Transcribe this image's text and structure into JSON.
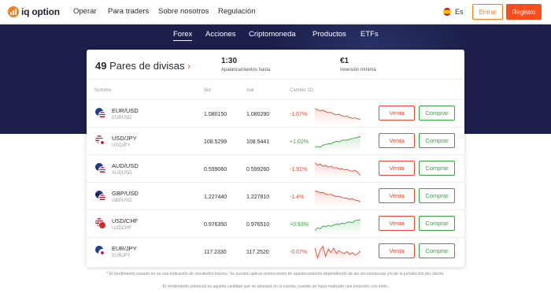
{
  "header": {
    "logo_text": "iq option",
    "nav": [
      "Operar",
      "Para traders",
      "Sobre nosotros",
      "Regulación"
    ],
    "language": "Es",
    "entrar_label": "Entrar",
    "registro_label": "Registro"
  },
  "tabs": [
    "Forex",
    "Acciones",
    "Criptomoneda",
    "Productos",
    "ETFs"
  ],
  "card": {
    "pairs_count": "49",
    "pairs_label": " Pares de divisas",
    "leverage_value": "1:30",
    "leverage_label": "Apalancamientos hasta",
    "min_invest_value": "€1",
    "min_invest_label": "Inversión mínima",
    "columns": [
      "Nombre",
      "Bid",
      "Ask",
      "Cambio 1D"
    ],
    "sell_label": "Venta",
    "buy_label": "Comprar"
  },
  "rows": [
    {
      "symbol": "EUR/USD",
      "sub": "EURUSD",
      "bid": "1.080150",
      "ask": "1.080290",
      "change": "-1.07%",
      "direction": "down",
      "flags": [
        "eu",
        "us"
      ],
      "trend": [
        0.2,
        0.28,
        0.32,
        0.3,
        0.38,
        0.44,
        0.42,
        0.5,
        0.55,
        0.52,
        0.6,
        0.66,
        0.62,
        0.7,
        0.75,
        0.72,
        0.78,
        0.8
      ]
    },
    {
      "symbol": "USD/JPY",
      "sub": "USDJPY",
      "bid": "108.5299",
      "ask": "108.5441",
      "change": "+1.02%",
      "direction": "up",
      "flags": [
        "us",
        "jp"
      ],
      "trend": [
        0.8,
        0.78,
        0.82,
        0.7,
        0.68,
        0.62,
        0.64,
        0.55,
        0.5,
        0.52,
        0.45,
        0.42,
        0.44,
        0.38,
        0.35,
        0.3,
        0.28,
        0.22
      ]
    },
    {
      "symbol": "AUD/USD",
      "sub": "AUDUSD",
      "bid": "0.599060",
      "ask": "0.599260",
      "change": "-1.91%",
      "direction": "down",
      "flags": [
        "au",
        "us"
      ],
      "trend": [
        0.15,
        0.3,
        0.22,
        0.35,
        0.3,
        0.4,
        0.35,
        0.45,
        0.42,
        0.5,
        0.48,
        0.55,
        0.52,
        0.6,
        0.62,
        0.58,
        0.7,
        0.85
      ]
    },
    {
      "symbol": "GBP/USD",
      "sub": "GBPUSD",
      "bid": "1.227440",
      "ask": "1.227810",
      "change": "-1.4%",
      "direction": "down",
      "flags": [
        "gb",
        "us"
      ],
      "trend": [
        0.2,
        0.22,
        0.3,
        0.28,
        0.36,
        0.4,
        0.38,
        0.45,
        0.5,
        0.48,
        0.55,
        0.58,
        0.6,
        0.65,
        0.62,
        0.7,
        0.72,
        0.8
      ]
    },
    {
      "symbol": "USD/CHF",
      "sub": "USDCHF",
      "bid": "0.976350",
      "ask": "0.976510",
      "change": "+0.93%",
      "direction": "up",
      "flags": [
        "us",
        "ch"
      ],
      "trend": [
        0.85,
        0.7,
        0.75,
        0.6,
        0.65,
        0.58,
        0.62,
        0.55,
        0.5,
        0.52,
        0.45,
        0.48,
        0.4,
        0.38,
        0.42,
        0.3,
        0.28,
        0.25
      ]
    },
    {
      "symbol": "EUR/JPY",
      "sub": "EURJPY",
      "bid": "117.2330",
      "ask": "117.2520",
      "change": "-0.07%",
      "direction": "down",
      "flags": [
        "eu",
        "jp"
      ],
      "trend": [
        0.3,
        0.85,
        0.4,
        0.2,
        0.75,
        0.35,
        0.55,
        0.3,
        0.6,
        0.45,
        0.55,
        0.6,
        0.5,
        0.65,
        0.55,
        0.7,
        0.6,
        0.45
      ]
    }
  ],
  "disclaimer": {
    "line1": "* El rendimiento pasado no es una indicación de resultados futuros. Se pueden aplicar restricciones de apalancamiento dependiendo de las circunstancias y/o de la jurisdicción del cliente.",
    "line2": "El rendimiento potencial es aquella cantidad que se abonará en la cuenta, cuando se haya realizado una inversión con éxito."
  },
  "colors": {
    "accent": "#fa4d1e",
    "sell": "#e8492f",
    "buy": "#2ea83a",
    "hero": "#1b1f4a"
  }
}
